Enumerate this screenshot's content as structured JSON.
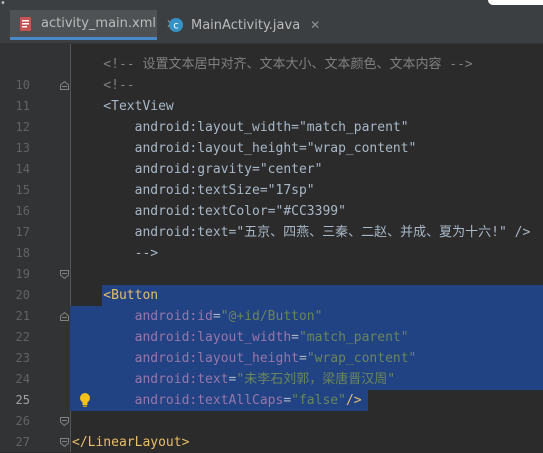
{
  "tabs": [
    {
      "label": "activity_main.xml",
      "icon": "xml-file-icon",
      "active": true
    },
    {
      "label": "MainActivity.java",
      "icon": "java-class-icon",
      "active": false
    }
  ],
  "colors": {
    "background": "#2b2b2b",
    "selection": "#214283",
    "tag": "#e8bf6a",
    "attribute": "#9876aa",
    "string": "#6a8759",
    "comment": "#808080",
    "text": "#a9b7c6"
  },
  "lines": [
    {
      "n": "",
      "tokens": [
        {
          "t": "    <!--",
          "c": "c-comment"
        },
        {
          "t": " 设置文本居中对齐、文本大小、文本颜色、文本内容 -->",
          "c": "c-comment"
        }
      ]
    },
    {
      "n": "10",
      "tokens": [
        {
          "t": "    <!--",
          "c": "c-comment"
        }
      ]
    },
    {
      "n": "11",
      "tokens": [
        {
          "t": "    <TextView",
          "c": "c-plain"
        }
      ]
    },
    {
      "n": "12",
      "tokens": [
        {
          "t": "        android:layout_width=\"match_parent\"",
          "c": "c-plain"
        }
      ]
    },
    {
      "n": "13",
      "tokens": [
        {
          "t": "        android:layout_height=\"wrap_content\"",
          "c": "c-plain"
        }
      ]
    },
    {
      "n": "14",
      "tokens": [
        {
          "t": "        android:gravity=\"center\"",
          "c": "c-plain"
        }
      ]
    },
    {
      "n": "15",
      "tokens": [
        {
          "t": "        android:textSize=\"17sp\"",
          "c": "c-plain"
        }
      ]
    },
    {
      "n": "16",
      "tokens": [
        {
          "t": "        android:textColor=\"#CC3399\"",
          "c": "c-plain"
        }
      ]
    },
    {
      "n": "17",
      "tokens": [
        {
          "t": "        android:text=\"五京、四燕、三秦、二赵、并成、夏为十六!\" />",
          "c": "c-plain"
        }
      ]
    },
    {
      "n": "18",
      "tokens": [
        {
          "t": "        -->",
          "c": "c-plain"
        }
      ]
    },
    {
      "n": "19",
      "tokens": []
    },
    {
      "n": "20",
      "tokens": [
        {
          "t": "    <Button",
          "c": "c-tag"
        }
      ]
    },
    {
      "n": "21",
      "tokens": [
        {
          "t": "        android:",
          "c": "c-attr"
        },
        {
          "t": "id",
          "c": "c-attr"
        },
        {
          "t": "=",
          "c": "c-plain"
        },
        {
          "t": "\"@+id/Button\"",
          "c": "c-val"
        }
      ]
    },
    {
      "n": "22",
      "tokens": [
        {
          "t": "        android:",
          "c": "c-attr"
        },
        {
          "t": "layout_width",
          "c": "c-attr"
        },
        {
          "t": "=",
          "c": "c-plain"
        },
        {
          "t": "\"match_parent\"",
          "c": "c-val"
        }
      ]
    },
    {
      "n": "23",
      "tokens": [
        {
          "t": "        android:",
          "c": "c-attr"
        },
        {
          "t": "layout_height",
          "c": "c-attr"
        },
        {
          "t": "=",
          "c": "c-plain"
        },
        {
          "t": "\"wrap_content\"",
          "c": "c-val"
        }
      ]
    },
    {
      "n": "24",
      "tokens": [
        {
          "t": "        android:",
          "c": "c-attr"
        },
        {
          "t": "text",
          "c": "c-attr"
        },
        {
          "t": "=",
          "c": "c-plain"
        },
        {
          "t": "\"未李石刘郭，梁唐晋汉周\"",
          "c": "c-val"
        }
      ]
    },
    {
      "n": "25",
      "tokens": [
        {
          "t": "        android:",
          "c": "c-attr"
        },
        {
          "t": "textAllCaps",
          "c": "c-attr"
        },
        {
          "t": "=",
          "c": "c-plain"
        },
        {
          "t": "\"false\"",
          "c": "c-val"
        },
        {
          "t": "/>",
          "c": "c-tag"
        }
      ]
    },
    {
      "n": "26",
      "tokens": []
    },
    {
      "n": "27",
      "tokens": [
        {
          "t": "</LinearLayout>",
          "c": "c-tag"
        }
      ]
    }
  ]
}
